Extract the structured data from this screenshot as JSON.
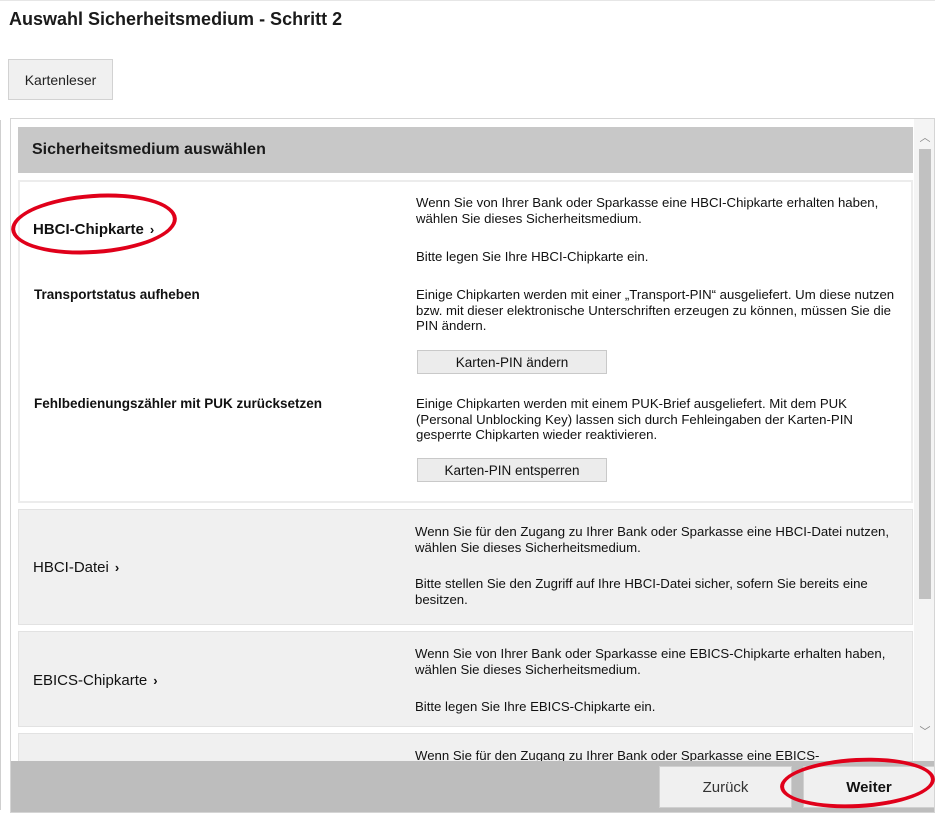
{
  "page": {
    "title": "Auswahl Sicherheitsmedium - Schritt 2"
  },
  "toolbar": {
    "card_reader_label": "Kartenleser"
  },
  "section": {
    "heading": "Sicherheitsmedium auswählen"
  },
  "media": [
    {
      "title": "HBCI-Chipkarte",
      "desc1": "Wenn Sie von Ihrer Bank oder Sparkasse eine HBCI-Chipkarte erhalten haben, wählen Sie dieses Sicherheitsmedium.",
      "desc2": "Bitte legen Sie Ihre HBCI-Chipkarte ein.",
      "actions": [
        {
          "label": "Transportstatus aufheben",
          "desc": "Einige Chipkarten werden mit einer „Transport-PIN“ ausgeliefert. Um diese nutzen bzw. mit dieser elektronische Unterschriften erzeugen zu können, müssen Sie die PIN ändern.",
          "button": "Karten-PIN ändern"
        },
        {
          "label": "Fehlbedienungszähler mit PUK zurücksetzen",
          "desc": "Einige Chipkarten werden mit einem PUK-Brief ausgeliefert. Mit dem PUK (Personal Unblocking Key) lassen sich durch Fehleingaben der Karten-PIN gesperrte Chipkarten wieder reaktivieren.",
          "button": "Karten-PIN entsperren"
        }
      ]
    },
    {
      "title": "HBCI-Datei",
      "desc1": "Wenn Sie für den Zugang zu Ihrer Bank oder Sparkasse eine HBCI-Datei nutzen, wählen Sie dieses Sicherheitsmedium.",
      "desc2": "Bitte stellen Sie den Zugriff auf Ihre HBCI-Datei sicher, sofern Sie bereits eine besitzen."
    },
    {
      "title": "EBICS-Chipkarte",
      "desc1": "Wenn Sie von Ihrer Bank oder Sparkasse eine EBICS-Chipkarte erhalten haben, wählen Sie dieses Sicherheitsmedium.",
      "desc2": "Bitte legen Sie Ihre EBICS-Chipkarte ein."
    },
    {
      "desc1": "Wenn Sie für den Zugang zu Ihrer Bank oder Sparkasse eine EBICS-"
    }
  ],
  "icons": {
    "chevron": "chevron-right-icon",
    "scroll_up": "chevron-up-icon",
    "scroll_down": "chevron-down-icon"
  },
  "chevron_glyph": "›",
  "footer": {
    "back_label": "Zurück",
    "next_label": "Weiter"
  },
  "colors": {
    "annotation": "#e0001a",
    "section_header": "#c8c8c8",
    "footer": "#bdbdbd"
  }
}
